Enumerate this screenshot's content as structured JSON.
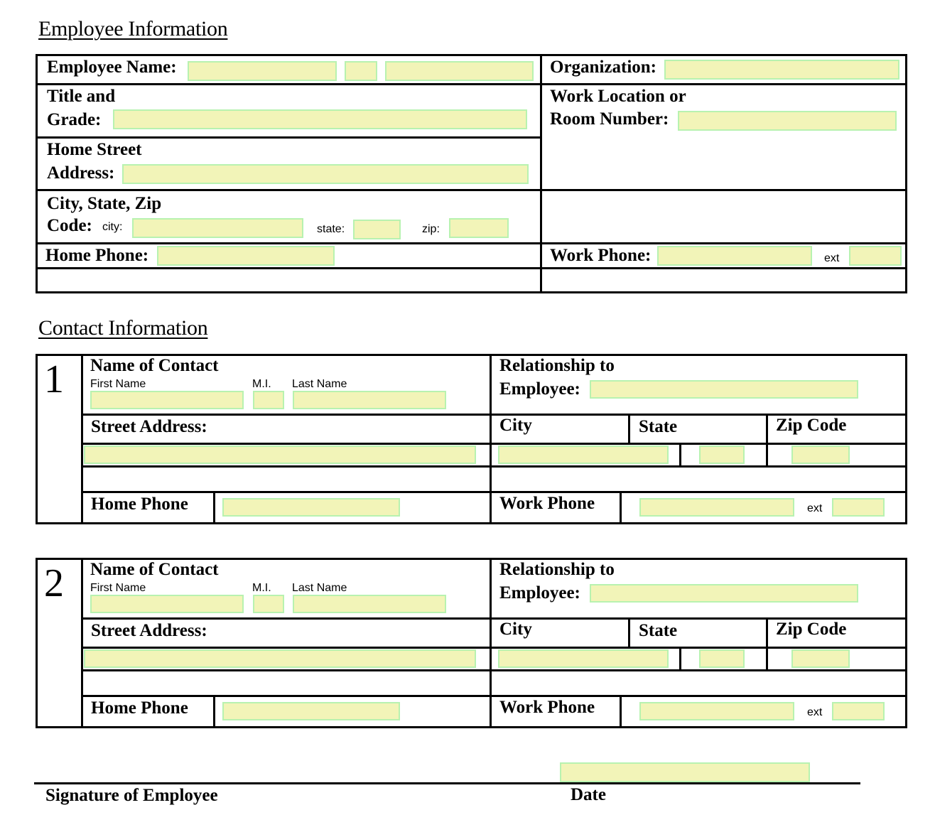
{
  "employee_section": {
    "heading": "Employee Information",
    "employee_name_label": "Employee Name:",
    "title_grade_label_1": "Title and",
    "title_grade_label_2": "Grade:",
    "home_street_label_1": "Home Street",
    "home_street_label_2": "Address:",
    "city_state_zip_label_1": "City, State, Zip",
    "city_state_zip_label_2": "Code:",
    "city_sublabel": "city:",
    "state_sublabel": "state:",
    "zip_sublabel": "zip:",
    "home_phone_label": "Home Phone:",
    "organization_label": "Organization:",
    "work_location_label_1": "Work Location or",
    "work_location_label_2": "Room Number:",
    "work_phone_label": "Work Phone:",
    "ext_label": "ext",
    "fields": {
      "employee_first_name": "",
      "employee_mi": "",
      "employee_last_name": "",
      "title_grade": "",
      "home_street": "",
      "city": "",
      "state": "",
      "zip": "",
      "home_phone": "",
      "organization": "",
      "work_location": "",
      "work_phone": "",
      "work_phone_ext": ""
    }
  },
  "contact_section": {
    "heading": "Contact Information",
    "contacts": [
      {
        "number": "1",
        "name_label": "Name of Contact",
        "first_name_label": "First Name",
        "mi_label": "M.I.",
        "last_name_label": "Last Name",
        "relationship_label_1": "Relationship to",
        "relationship_label_2": "Employee:",
        "street_label": "Street Address:",
        "city_label": "City",
        "state_label": "State",
        "zip_label": "Zip Code",
        "home_phone_label": "Home Phone",
        "work_phone_label": "Work Phone",
        "ext_label": "ext",
        "values": {
          "first_name": "",
          "mi": "",
          "last_name": "",
          "relationship": "",
          "street": "",
          "city": "",
          "state": "",
          "zip": "",
          "home_phone": "",
          "work_phone": "",
          "ext": ""
        }
      },
      {
        "number": "2",
        "name_label": "Name of Contact",
        "first_name_label": "First Name",
        "mi_label": "M.I.",
        "last_name_label": "Last Name",
        "relationship_label_1": "Relationship to",
        "relationship_label_2": "Employee:",
        "street_label": "Street Address:",
        "city_label": "City",
        "state_label": "State",
        "zip_label": "Zip Code",
        "home_phone_label": "Home Phone",
        "work_phone_label": "Work Phone",
        "ext_label": "ext",
        "values": {
          "first_name": "",
          "mi": "",
          "last_name": "",
          "relationship": "",
          "street": "",
          "city": "",
          "state": "",
          "zip": "",
          "home_phone": "",
          "work_phone": "",
          "ext": ""
        }
      }
    ]
  },
  "signature": {
    "signature_label": "Signature of Employee",
    "date_label": "Date",
    "date_value": ""
  }
}
